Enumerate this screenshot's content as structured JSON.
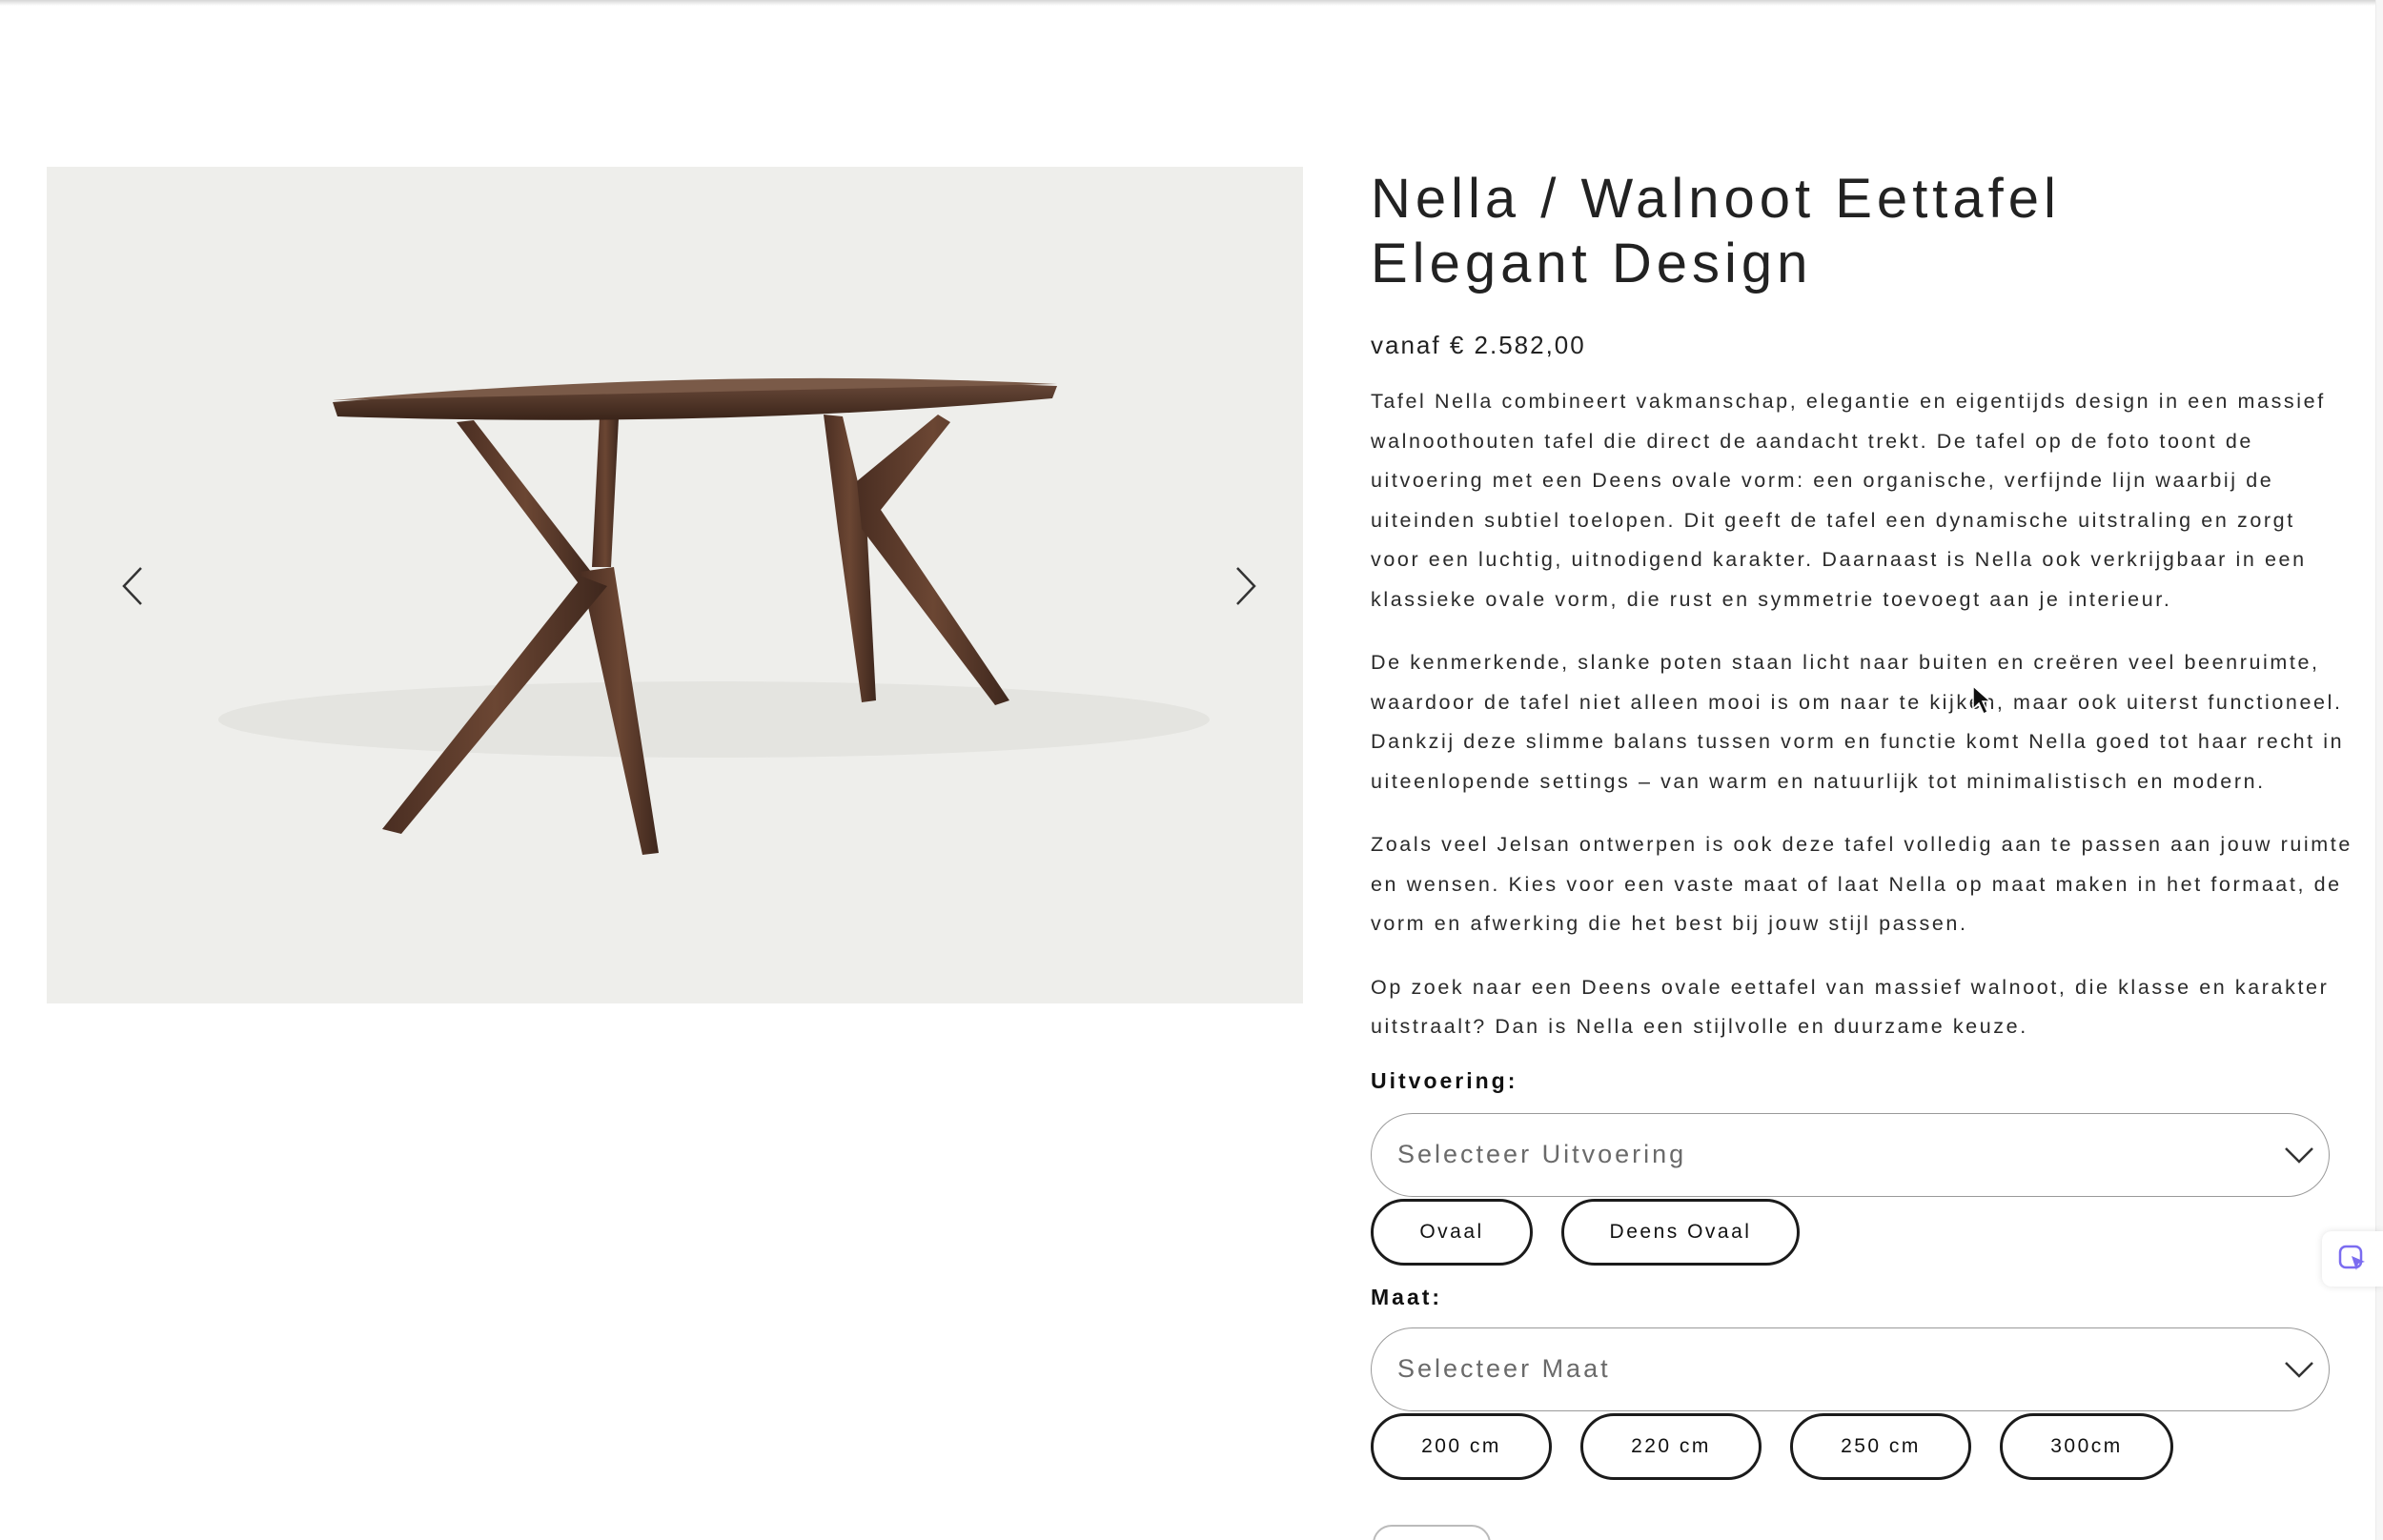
{
  "product": {
    "title_line1": "Nella / Walnoot Eettafel",
    "title_line2": "Elegant Design",
    "price": "vanaf € 2.582,00",
    "description": [
      [
        "Tafel Nella combineert vakmanschap, elegantie en eigentijds design in een massief",
        "walnoothouten tafel die direct de aandacht trekt. De tafel op de foto toont de",
        "uitvoering met een Deens ovale vorm: een organische, verfijnde lijn waarbij de",
        "uiteinden subtiel toelopen. Dit geeft de tafel een dynamische uitstraling en zorgt",
        "voor een luchtig, uitnodigend karakter. Daarnaast is Nella ook verkrijgbaar in een",
        "klassieke ovale vorm, die rust en symmetrie toevoegt aan je interieur."
      ],
      [
        "De kenmerkende, slanke poten staan licht naar buiten en creëren veel beenruimte,",
        "waardoor de tafel niet alleen mooi is om naar te kijken, maar ook uiterst functioneel.",
        "Dankzij deze slimme balans tussen vorm en functie komt Nella goed tot haar recht in",
        "uiteenlopende settings – van warm en natuurlijk tot minimalistisch en modern."
      ],
      [
        "Zoals veel Jelsan ontwerpen is ook deze tafel volledig aan te passen aan jouw ruimte",
        "en wensen. Kies voor een vaste maat of laat Nella op maat maken in het formaat, de",
        "vorm en afwerking die het best bij jouw stijl passen."
      ],
      [
        "Op zoek naar een Deens ovale eettafel van massief walnoot, die klasse en karakter",
        "uitstraalt? Dan is Nella een stijlvolle en duurzame keuze."
      ]
    ]
  },
  "options": {
    "uitvoering": {
      "label": "Uitvoering:",
      "placeholder": "Selecteer Uitvoering",
      "choices": [
        "Ovaal",
        "Deens Ovaal"
      ]
    },
    "maat": {
      "label": "Maat:",
      "placeholder": "Selecteer Maat",
      "choices": [
        "200 cm",
        "220 cm",
        "250 cm",
        "300cm"
      ]
    }
  },
  "gallery": {
    "prev_icon": "chevron-left-icon",
    "next_icon": "chevron-right-icon",
    "background_color": "#eeeeeb",
    "wood_color": "#5a3a2b"
  },
  "colors": {
    "text": "#222222",
    "pill_border": "#1b1b1b",
    "select_border": "#9a9a9a",
    "widget_accent": "#7b6cf0"
  }
}
